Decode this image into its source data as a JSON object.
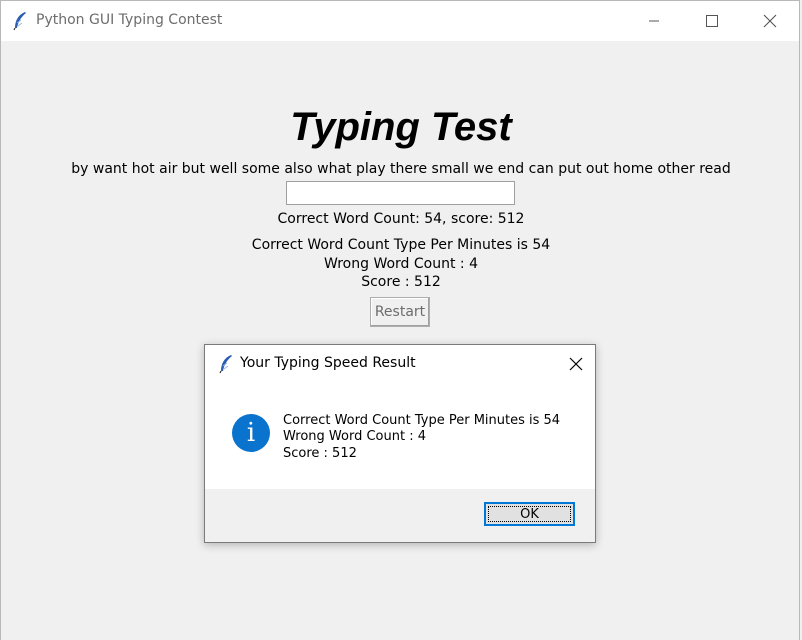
{
  "window": {
    "title": "Python GUI Typing Contest"
  },
  "main": {
    "heading": "Typing Test",
    "sample_text": "by want hot air but well some also what play there small we end can put out home other read",
    "entry_value": "",
    "count_line": "Correct Word Count: 54, score: 512",
    "result_line_1": "Correct Word Count Type Per Minutes is 54",
    "result_line_2": "Wrong Word Count : 4",
    "result_line_3": "Score : 512",
    "restart_label": "Restart"
  },
  "dialog": {
    "title": "Your Typing Speed Result",
    "icon": "info-icon",
    "message_line_1": "Correct Word Count Type Per Minutes is 54",
    "message_line_2": "Wrong Word Count : 4",
    "message_line_3": "Score : 512",
    "ok_label": "OK"
  },
  "colors": {
    "info_icon": "#0a73cd",
    "ok_focus_border": "#0078d7"
  }
}
